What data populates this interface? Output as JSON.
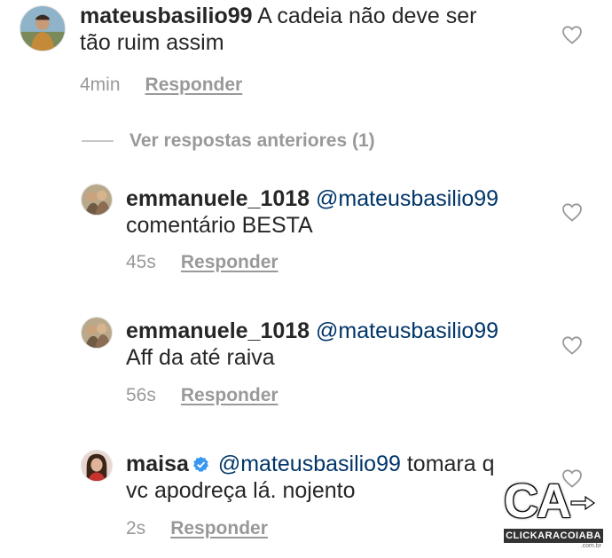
{
  "comments": [
    {
      "username": "mateusbasilio99",
      "mention": "",
      "text": "A cadeia não deve ser",
      "text_line2": "tão ruim assim",
      "time": "4min",
      "reply_label": "Responder",
      "verified": false,
      "avatar_icon": "profile-photo-man-outdoors"
    },
    {
      "username": "emmanuele_1018",
      "mention": "@mateusbasilio99",
      "text": "comentário BESTA",
      "time": "45s",
      "reply_label": "Responder",
      "verified": false,
      "avatar_icon": "profile-photo-children"
    },
    {
      "username": "emmanuele_1018",
      "mention": "@mateusbasilio99",
      "text": "Aff da até raiva",
      "time": "56s",
      "reply_label": "Responder",
      "verified": false,
      "avatar_icon": "profile-photo-children"
    },
    {
      "username": "maisa",
      "mention": "@mateusbasilio99",
      "text": "tomara q",
      "text_line2": "vc apodreça lá. nojento",
      "time": "2s",
      "reply_label": "Responder",
      "verified": true,
      "avatar_icon": "profile-photo-woman"
    }
  ],
  "view_previous_replies": "Ver respostas anteriores (1)",
  "watermark": {
    "letters": "CA",
    "name": "CLICKARACOIABA",
    "domain": ".com.br"
  },
  "colors": {
    "text": "#262626",
    "secondary": "#999999",
    "mention": "#003569",
    "verified": "#3897f0"
  }
}
